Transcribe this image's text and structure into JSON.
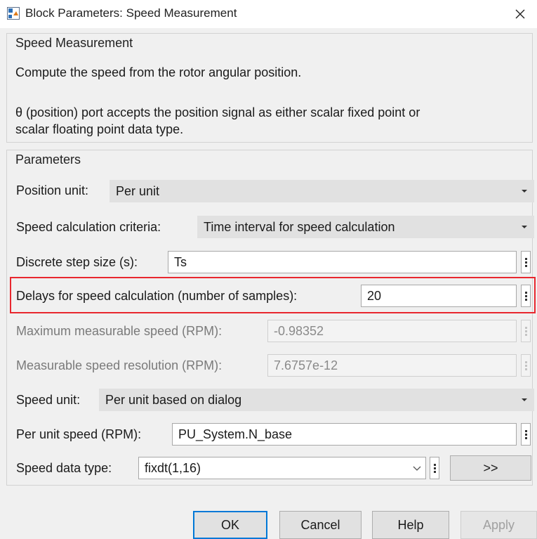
{
  "window": {
    "title": "Block Parameters: Speed Measurement",
    "close_glyph": "✕"
  },
  "description": {
    "group_title": "Speed Measurement",
    "line1": "Compute the speed from the rotor angular position.",
    "line2": "θ (position) port accepts the position signal as either scalar fixed point or",
    "line3": "scalar floating point data type."
  },
  "parameters": {
    "group_title": "Parameters",
    "position_unit": {
      "label": "Position unit:",
      "value": "Per unit"
    },
    "speed_calc_criteria": {
      "label": "Speed calculation criteria:",
      "value": "Time interval for speed calculation"
    },
    "discrete_step": {
      "label": "Discrete step size (s):",
      "value": "Ts"
    },
    "delays": {
      "label": "Delays for speed calculation (number of samples):",
      "value": "20"
    },
    "max_speed": {
      "label": "Maximum measurable speed (RPM):",
      "value": "-0.98352"
    },
    "resolution": {
      "label": "Measurable speed resolution (RPM):",
      "value": "7.6757e-12"
    },
    "speed_unit": {
      "label": "Speed unit:",
      "value": "Per unit based on dialog"
    },
    "per_unit_speed": {
      "label": "Per unit speed (RPM):",
      "value": "PU_System.N_base"
    },
    "speed_data_type": {
      "label": "Speed data type:",
      "value": "fixdt(1,16)",
      "more_label": ">>"
    }
  },
  "buttons": {
    "ok": "OK",
    "cancel": "Cancel",
    "help": "Help",
    "apply": "Apply"
  },
  "colors": {
    "highlight": "#e8272e",
    "focus": "#0078d7"
  }
}
